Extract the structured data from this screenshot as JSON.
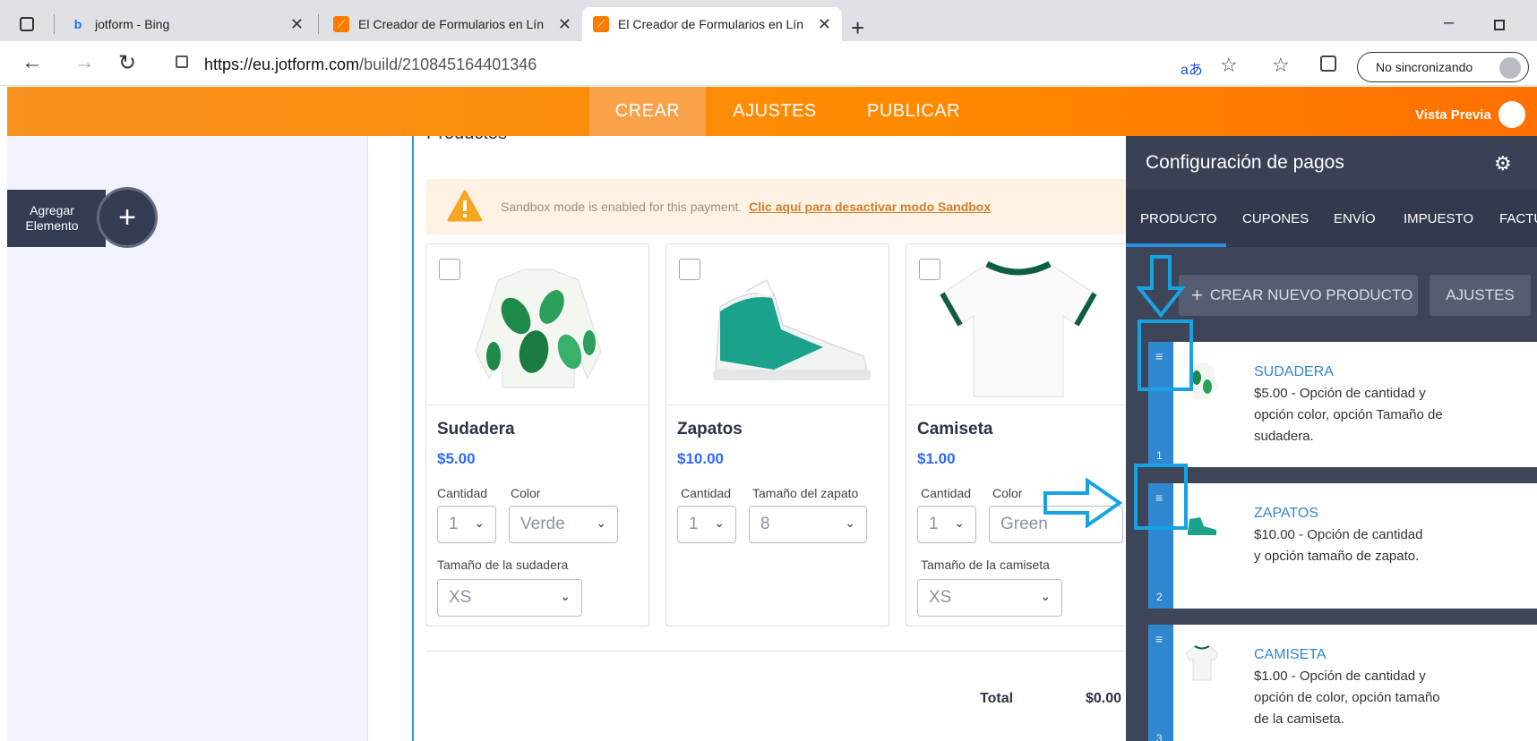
{
  "browser": {
    "tabs": [
      {
        "title": "jotform - Bing"
      },
      {
        "title": "El Creador de Formularios en Lín"
      },
      {
        "title": "El Creador de Formularios en Lín"
      }
    ],
    "url_host": "https://eu.jotform.com",
    "url_path": "/build/210845164401346",
    "sync_label": "No sincronizando",
    "translate_icon": "aあ"
  },
  "topbar": {
    "nav": [
      "CREAR",
      "AJUSTES",
      "PUBLICAR"
    ],
    "preview_label": "Vista Previa"
  },
  "left": {
    "add_element_line1": "Agregar",
    "add_element_line2": "Elemento"
  },
  "form": {
    "section_title": "Productos",
    "sandbox_text": "Sandbox mode is enabled for this payment.",
    "sandbox_link": "Clic aquí para desactivar modo Sandbox",
    "products": [
      {
        "name": "Sudadera",
        "price": "$5.00",
        "label1": "Cantidad",
        "label2": "Color",
        "qty": "1",
        "opt": "Verde",
        "label3": "Tamaño de la sudadera",
        "opt2": "XS"
      },
      {
        "name": "Zapatos",
        "price": "$10.00",
        "label1": "Cantidad",
        "label2": "Tamaño del zapato",
        "qty": "1",
        "opt": "8"
      },
      {
        "name": "Camiseta",
        "price": "$1.00",
        "label1": "Cantidad",
        "label2": "Color",
        "qty": "1",
        "opt": "Green",
        "label3": "Tamaño de la camiseta",
        "opt2": "XS"
      }
    ],
    "total_label": "Total",
    "total_value": "$0.00"
  },
  "panel": {
    "title": "Configuración de pagos",
    "tabs": [
      "PRODUCTO",
      "CUPONES",
      "ENVÍO",
      "IMPUESTO",
      "FACTU"
    ],
    "new_product": "CREAR NUEVO PRODUCTO",
    "settings": "AJUSTES",
    "items": [
      {
        "num": "1",
        "title": "SUDADERA",
        "desc": "$5.00 - Opción de cantidad y opción color, opción Tamaño de sudadera."
      },
      {
        "num": "2",
        "title": "ZAPATOS",
        "desc": "$10.00 - Opción de cantidad y opción tamaño de zapato."
      },
      {
        "num": "3",
        "title": "CAMISETA",
        "desc": "$1.00 - Opción de cantidad y opción de color, opción tamaño de la camiseta."
      }
    ]
  },
  "colors": {
    "brand_orange": "#ff8a00",
    "accent_blue": "#2f88cf",
    "annotation_blue": "#17a3e3",
    "panel_dark": "#3e4559"
  }
}
